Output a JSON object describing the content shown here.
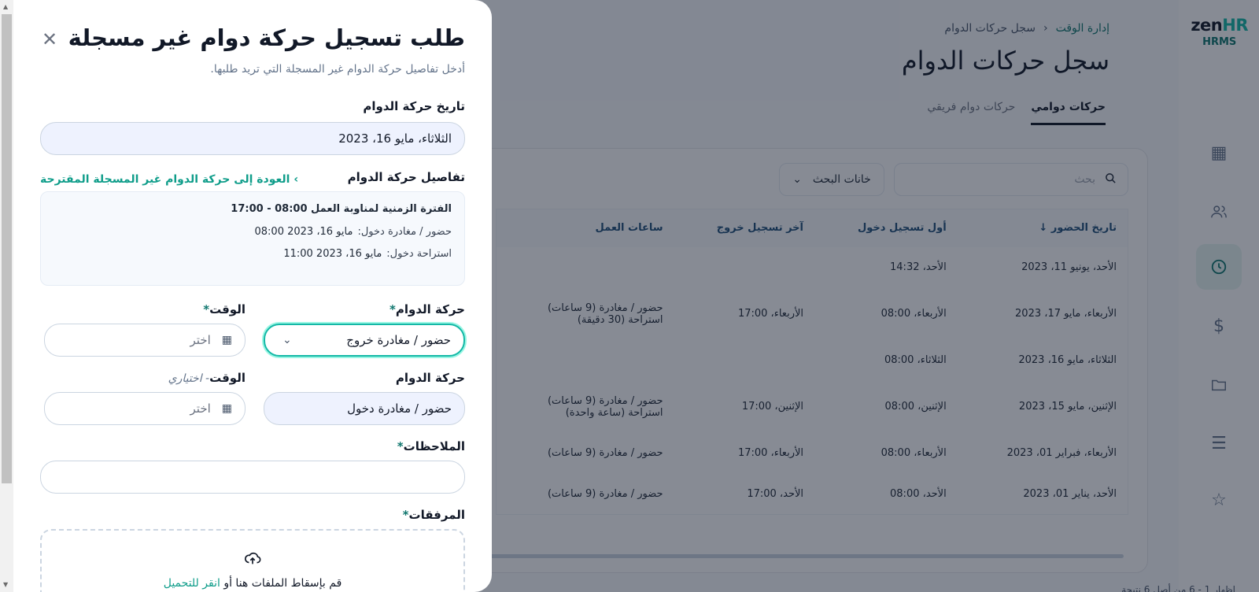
{
  "brand": {
    "logo_left": "zen",
    "logo_right": "HR",
    "product": "HRMS"
  },
  "rail": {
    "icons": [
      "grid-icon",
      "users-icon",
      "clock-icon",
      "dollar-icon",
      "folder-icon",
      "list-icon",
      "star-icon"
    ]
  },
  "breadcrumb": {
    "parent": "إدارة الوقت",
    "current": "سجل حركات الدوام"
  },
  "page": {
    "title": "سجل حركات الدوام"
  },
  "tabs": [
    {
      "label": "حركات دوامي",
      "active": true
    },
    {
      "label": "حركات دوام فريقي",
      "active": false
    }
  ],
  "search": {
    "placeholder": "بحث"
  },
  "filter": {
    "label": "خانات البحث"
  },
  "table": {
    "headers": [
      "تاريخ الحضور",
      "أول تسجيل دخول",
      "آخر تسجيل خروج",
      "ساعات العمل"
    ],
    "rows": [
      [
        "الأحد، يونيو 11، 2023",
        "الأحد، 14:32",
        "",
        ""
      ],
      [
        "الأربعاء، مايو 17، 2023",
        "الأربعاء، 08:00",
        "الأربعاء، 17:00",
        "حضور / مغادرة (9 ساعات)",
        "استراحة (30 دقيقة)"
      ],
      [
        "الثلاثاء، مايو 16، 2023",
        "الثلاثاء، 08:00",
        "",
        ""
      ],
      [
        "الإثنين، مايو 15، 2023",
        "الإثنين، 08:00",
        "الإثنين، 17:00",
        "حضور / مغادرة (9 ساعات)",
        "استراحة (ساعة واحدة)"
      ],
      [
        "الأربعاء، فبراير 01، 2023",
        "الأربعاء، 08:00",
        "الأربعاء، 17:00",
        "حضور / مغادرة (9 ساعات)"
      ],
      [
        "الأحد، يناير 01، 2023",
        "الأحد، 08:00",
        "الأحد، 17:00",
        "حضور / مغادرة (9 ساعات)"
      ]
    ]
  },
  "pagination": {
    "text": "إظهار 1 - 6 من أصل 6 نتيجة"
  },
  "modal": {
    "title": "طلب تسجيل حركة دوام غير مسجلة",
    "subtitle": "أدخل تفاصيل حركة الدوام غير المسجلة التي تريد طلبها.",
    "date_label": "تاريخ حركة الدوام",
    "date_value": "الثلاثاء، مايو 16، 2023",
    "details_label": "تفاصيل حركة الدوام",
    "back_link": "العودة إلى حركة الدوام غير المسجلة المقترحة",
    "details": {
      "shift": "الفترة الزمنية لمناوبة العمل 08:00 - 17:00",
      "row1_key": "حضور / مغادرة دخول:",
      "row1_val": "مايو 16، 2023 08:00",
      "row2_key": "استراحة دخول:",
      "row2_val": "مايو 16، 2023 11:00"
    },
    "movement_label": "حركة الدوام",
    "time_label": "الوقت",
    "optional_text": "اختياري",
    "movement1_value": "حضور / مغادرة خروج",
    "movement2_value": "حضور / مغادرة دخول",
    "time_placeholder": "اختر",
    "notes_label": "الملاحظات",
    "attachments_label": "المرفقات",
    "upload_text": "قم بإسقاط الملفات هنا أو",
    "upload_link": "انقر للتحميل",
    "required_mark": "*"
  }
}
